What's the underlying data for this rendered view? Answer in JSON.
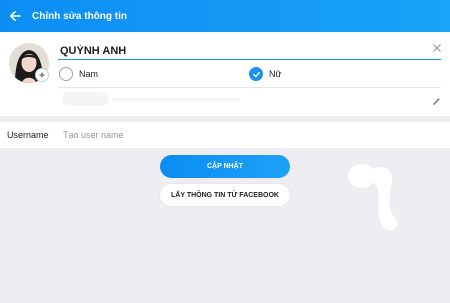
{
  "header": {
    "title": "Chỉnh sửa thông tin",
    "back_icon": "arrow-left-icon"
  },
  "profile": {
    "name": "QUỲNH ANH",
    "clear_icon": "close-icon",
    "avatar_badge_icon": "plus-icon",
    "edit_icon": "pencil-icon"
  },
  "gender": {
    "options": [
      {
        "label": "Nam",
        "selected": false
      },
      {
        "label": "Nữ",
        "selected": true
      }
    ]
  },
  "username": {
    "label": "Username",
    "placeholder": "Tạo user name",
    "value": ""
  },
  "actions": {
    "update_label": "CẬP NHẬT",
    "facebook_label": "LẤY THÔNG TIN TỪ FACEBOOK"
  },
  "colors": {
    "accent": "#1B8FF3",
    "background": "#EDEDF2"
  }
}
